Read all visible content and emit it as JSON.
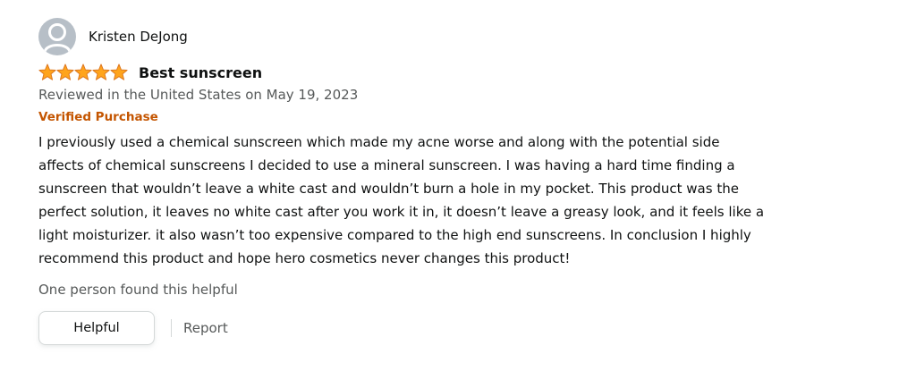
{
  "review": {
    "reviewer_name": "Kristen DeJong",
    "avatar_icon": "user-silhouette-icon",
    "rating": 5,
    "rating_max": 5,
    "star_color": "#ffa41c",
    "title": "Best sunscreen",
    "date_text": "Reviewed in the United States on May 19, 2023",
    "verified_label": "Verified Purchase",
    "body": "I previously used a chemical sunscreen which made my acne worse and along with the potential side\naffects of chemical sunscreens I decided to use a mineral sunscreen. I was having a hard time finding a\nsunscreen that wouldn’t leave a white cast and wouldn’t burn a hole in my pocket. This product was the\nperfect solution, it leaves no white cast after you work it in, it doesn’t leave a greasy look, and it feels like a\nlight moisturizer. it also wasn’t too expensive compared to the high end sunscreens. In conclusion I highly\nrecommend this product and hope hero cosmetics never changes this product!",
    "helpful_count_text": "One person found this helpful",
    "helpful_button_label": "Helpful",
    "report_label": "Report"
  }
}
